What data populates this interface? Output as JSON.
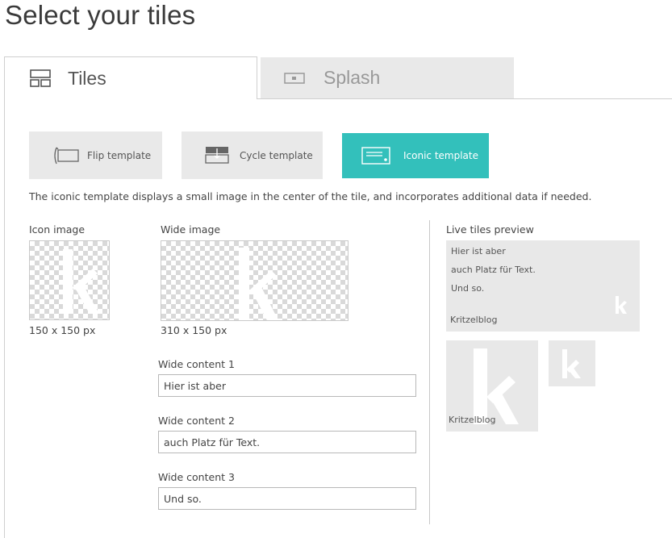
{
  "page": {
    "title": "Select your tiles"
  },
  "tabs": [
    {
      "label": "Tiles",
      "icon": "tiles-icon",
      "active": true
    },
    {
      "label": "Splash",
      "icon": "splash-icon",
      "active": false
    }
  ],
  "templates": [
    {
      "label": "Flip template",
      "icon": "flip-icon",
      "selected": false
    },
    {
      "label": "Cycle template",
      "icon": "cycle-icon",
      "selected": false
    },
    {
      "label": "Iconic template",
      "icon": "iconic-icon",
      "selected": true
    }
  ],
  "description": "The iconic template displays a small image in the center of the tile, and incorporates additional data if needed.",
  "icon_image": {
    "label": "Icon image",
    "size": "150 x 150 px"
  },
  "wide_image": {
    "label": "Wide image",
    "size": "310 x 150 px"
  },
  "wide_content": [
    {
      "label": "Wide content 1",
      "value": "Hier ist aber"
    },
    {
      "label": "Wide content 2",
      "value": "auch Platz für Text."
    },
    {
      "label": "Wide content 3",
      "value": "Und so."
    }
  ],
  "preview": {
    "title": "Live tiles preview",
    "wide_lines": [
      "Hier ist aber",
      "auch Platz für Text.",
      "Und so."
    ],
    "brand": "Kritzelblog",
    "logo_letter": "k"
  },
  "colors": {
    "accent": "#33c0bb",
    "tile_bg": "#e8e8e8",
    "tab_inactive": "#e9e9e9"
  }
}
